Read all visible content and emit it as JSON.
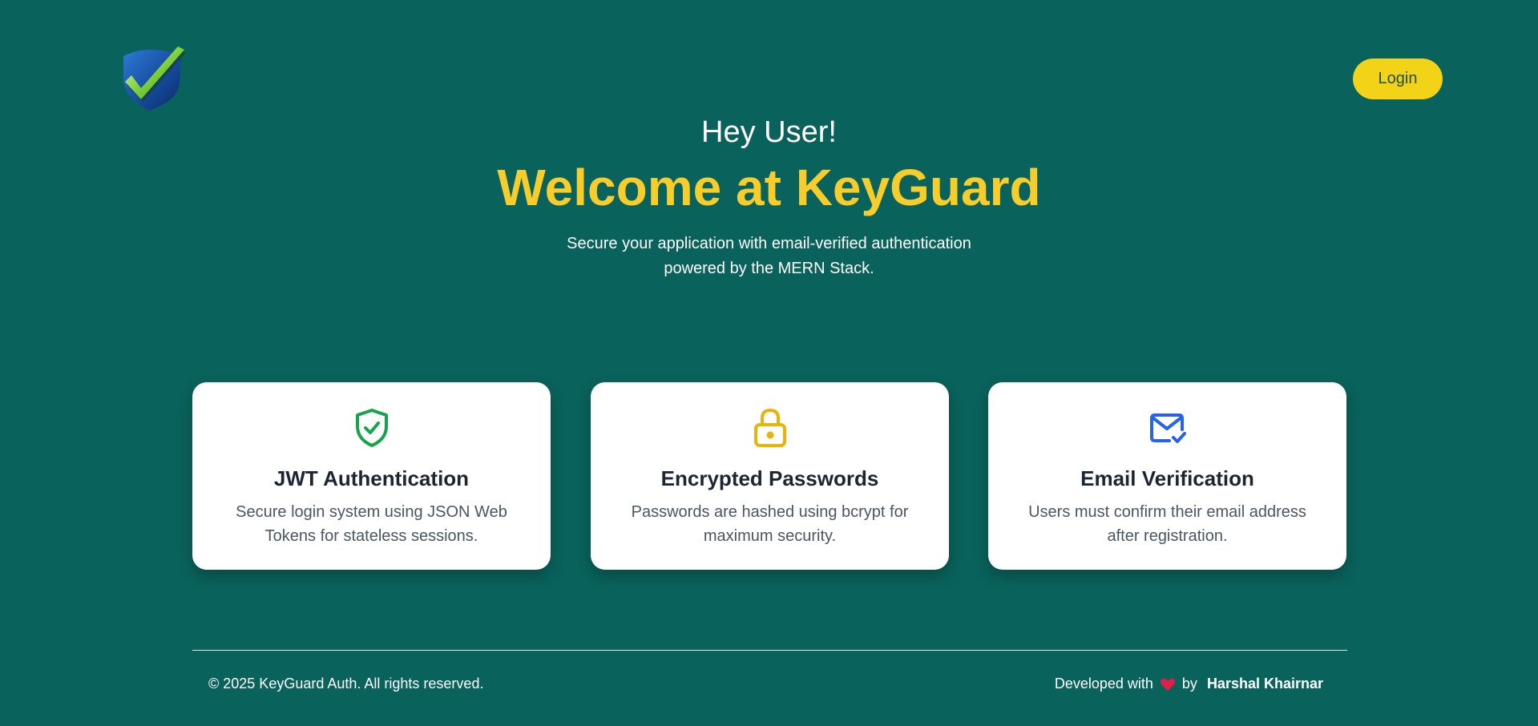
{
  "header": {
    "logo_icon": "shield-check-logo",
    "login_label": "Login"
  },
  "hero": {
    "greeting": "Hey User!",
    "headline": "Welcome at KeyGuard",
    "tagline": "Secure your application with email-verified authentication powered by the MERN Stack."
  },
  "features": [
    {
      "icon": "shield-check-icon",
      "title": "JWT Authentication",
      "description": "Secure login system using JSON Web Tokens for stateless sessions."
    },
    {
      "icon": "lock-icon",
      "title": "Encrypted Passwords",
      "description": "Passwords are hashed using bcrypt for maximum security."
    },
    {
      "icon": "mail-check-icon",
      "title": "Email Verification",
      "description": "Users must confirm their email address after registration."
    }
  ],
  "footer": {
    "copyright": "© 2025 KeyGuard Auth. All rights reserved.",
    "developed_with": "Developed with",
    "heart_icon": "heart-icon",
    "by": "by",
    "author": "Harshal Khairnar"
  },
  "colors": {
    "background": "#0a625c",
    "accent_yellow": "#f7cd2b",
    "button_yellow": "#f3d318",
    "card_bg": "#ffffff",
    "shield_green": "#16a34a",
    "lock_amber": "#eab308",
    "mail_blue": "#2563eb",
    "heart_red": "#e11d48"
  }
}
